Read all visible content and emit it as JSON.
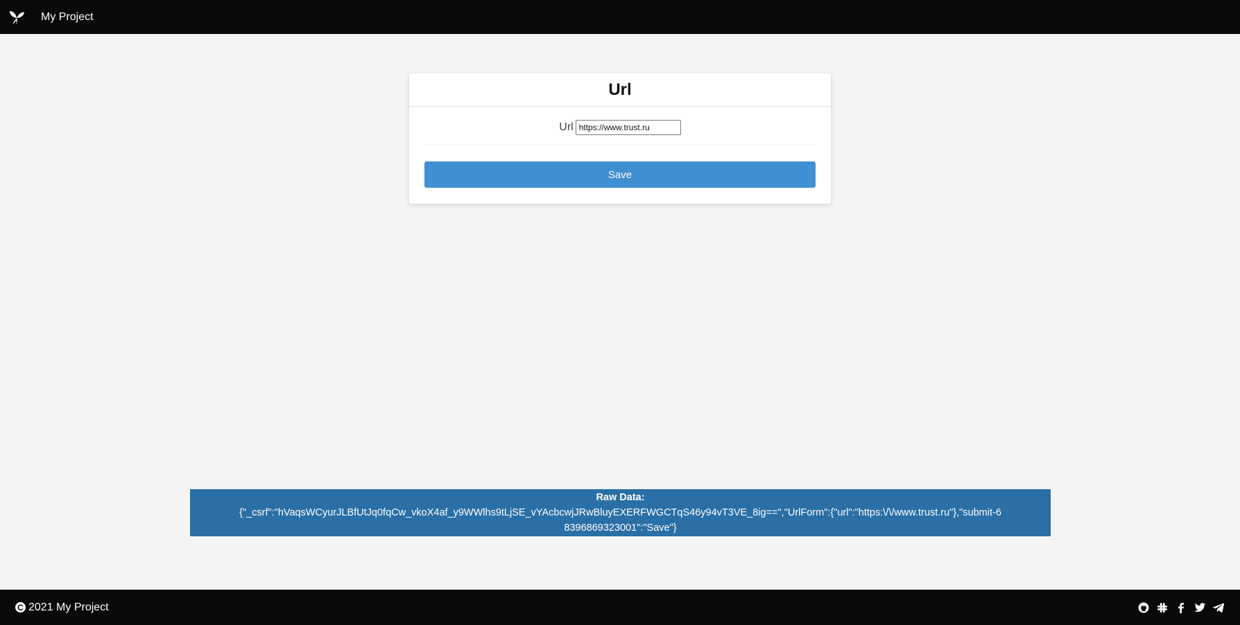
{
  "navbar": {
    "brand": "My Project",
    "logo_icon": "yii-logo-icon"
  },
  "form": {
    "title": "Url",
    "url_label": "Url",
    "url_value": "https://www.trust.ru",
    "save_label": "Save"
  },
  "raw_data": {
    "title": "Raw Data:",
    "content": "{\"_csrf\":\"hVaqsWCyurJLBfUtJq0fqCw_vkoX4af_y9WWlhs9tLjSE_vYAcbcwjJRwBluyEXERFWGCTqS46y94vT3VE_8ig==\",\"UrlForm\":{\"url\":\"https:\\/\\/www.trust.ru\"},\"submit-68396869323001\":\"Save\"}"
  },
  "footer": {
    "copyright": "2021 My Project",
    "social_icons": [
      "github-icon",
      "slack-icon",
      "facebook-icon",
      "twitter-icon",
      "telegram-icon"
    ]
  },
  "colors": {
    "navbar_bg": "#0a0a0a",
    "page_bg": "#f4f4f4",
    "button_bg": "#3f8fd2",
    "raw_bg": "#2a6fa6"
  }
}
